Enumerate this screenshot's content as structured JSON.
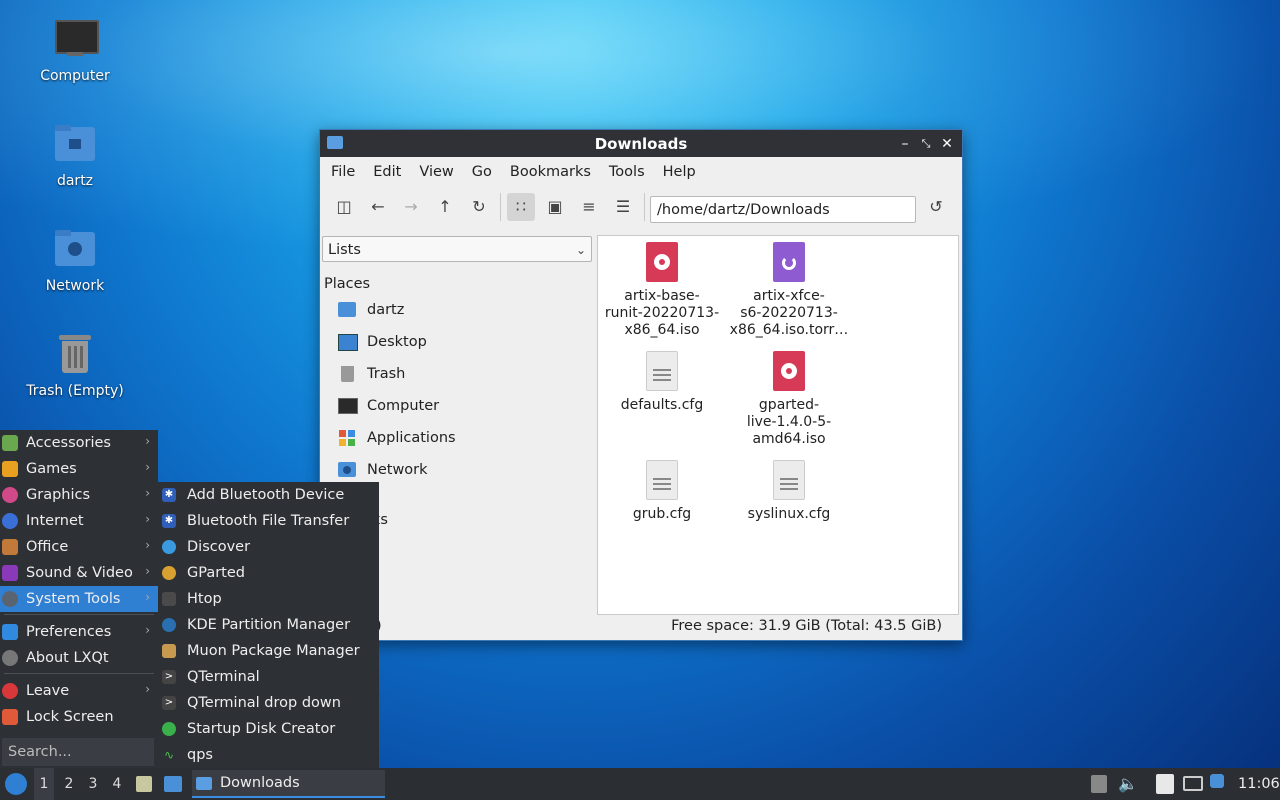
{
  "desktop": {
    "icons": [
      {
        "label": "Computer",
        "icon": "computer-icon"
      },
      {
        "label": "dartz",
        "icon": "home-folder-icon"
      },
      {
        "label": "Network",
        "icon": "network-icon"
      },
      {
        "label": "Trash (Empty)",
        "icon": "trash-icon"
      }
    ]
  },
  "window": {
    "title": "Downloads",
    "menu": [
      "File",
      "Edit",
      "View",
      "Go",
      "Bookmarks",
      "Tools",
      "Help"
    ],
    "path": "/home/dartz/Downloads",
    "side_combo": "Lists",
    "places_heading": "Places",
    "places": [
      "dartz",
      "Desktop",
      "Trash",
      "Computer",
      "Applications",
      "Network"
    ],
    "bookmarks_partial": "rks",
    "status_left_partial": ")",
    "status_free": "Free space: 31.9 GiB (Total: 43.5 GiB)",
    "files": [
      {
        "name": "artix-base-\nrunit-20220713-\nx86_64.iso",
        "type": "iso"
      },
      {
        "name": "artix-xfce-\ns6-20220713-\nx86_64.iso.torr…",
        "type": "torrent"
      },
      {
        "name": "defaults.cfg",
        "type": "text"
      },
      {
        "name": "gparted-\nlive-1.4.0-5-\namd64.iso",
        "type": "iso"
      },
      {
        "name": "grub.cfg",
        "type": "text"
      },
      {
        "name": "syslinux.cfg",
        "type": "text"
      }
    ]
  },
  "menu": {
    "items": [
      "Accessories",
      "Games",
      "Graphics",
      "Internet",
      "Office",
      "Sound & Video",
      "System Tools",
      "Preferences",
      "About LXQt",
      "Leave",
      "Lock Screen"
    ],
    "search_placeholder": "Search...",
    "submenu": [
      "Add Bluetooth Device",
      "Bluetooth File Transfer",
      "Discover",
      "GParted",
      "Htop",
      "KDE Partition Manager",
      "Muon Package Manager",
      "QTerminal",
      "QTerminal drop down",
      "Startup Disk Creator",
      "qps"
    ]
  },
  "taskbar": {
    "workspaces": [
      "1",
      "2",
      "3",
      "4"
    ],
    "task_label": "Downloads",
    "clock": "11:06"
  },
  "colors": {
    "accent": "#2f7fd3",
    "menu_bg": "#2d3035",
    "iso_red": "#d63a57",
    "torrent_purple": "#8e5bd1"
  }
}
